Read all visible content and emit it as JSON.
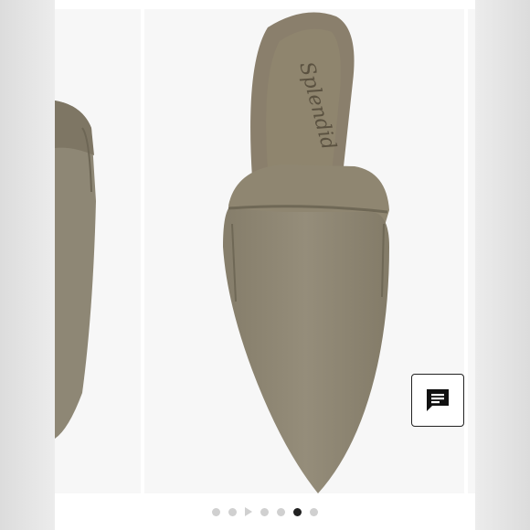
{
  "product": {
    "brand_signature": "Splendid",
    "shoe_color": "#8c8472",
    "insole_color": "#8a7f6c"
  },
  "carousel": {
    "slide_count": 7,
    "active_index": 5,
    "video_indicator_index": 2,
    "active_dot_color": "#222222",
    "inactive_dot_color": "#d0d0d0"
  },
  "chat_button": {
    "icon": "chat-message-icon"
  },
  "caption": {
    "text": ""
  }
}
